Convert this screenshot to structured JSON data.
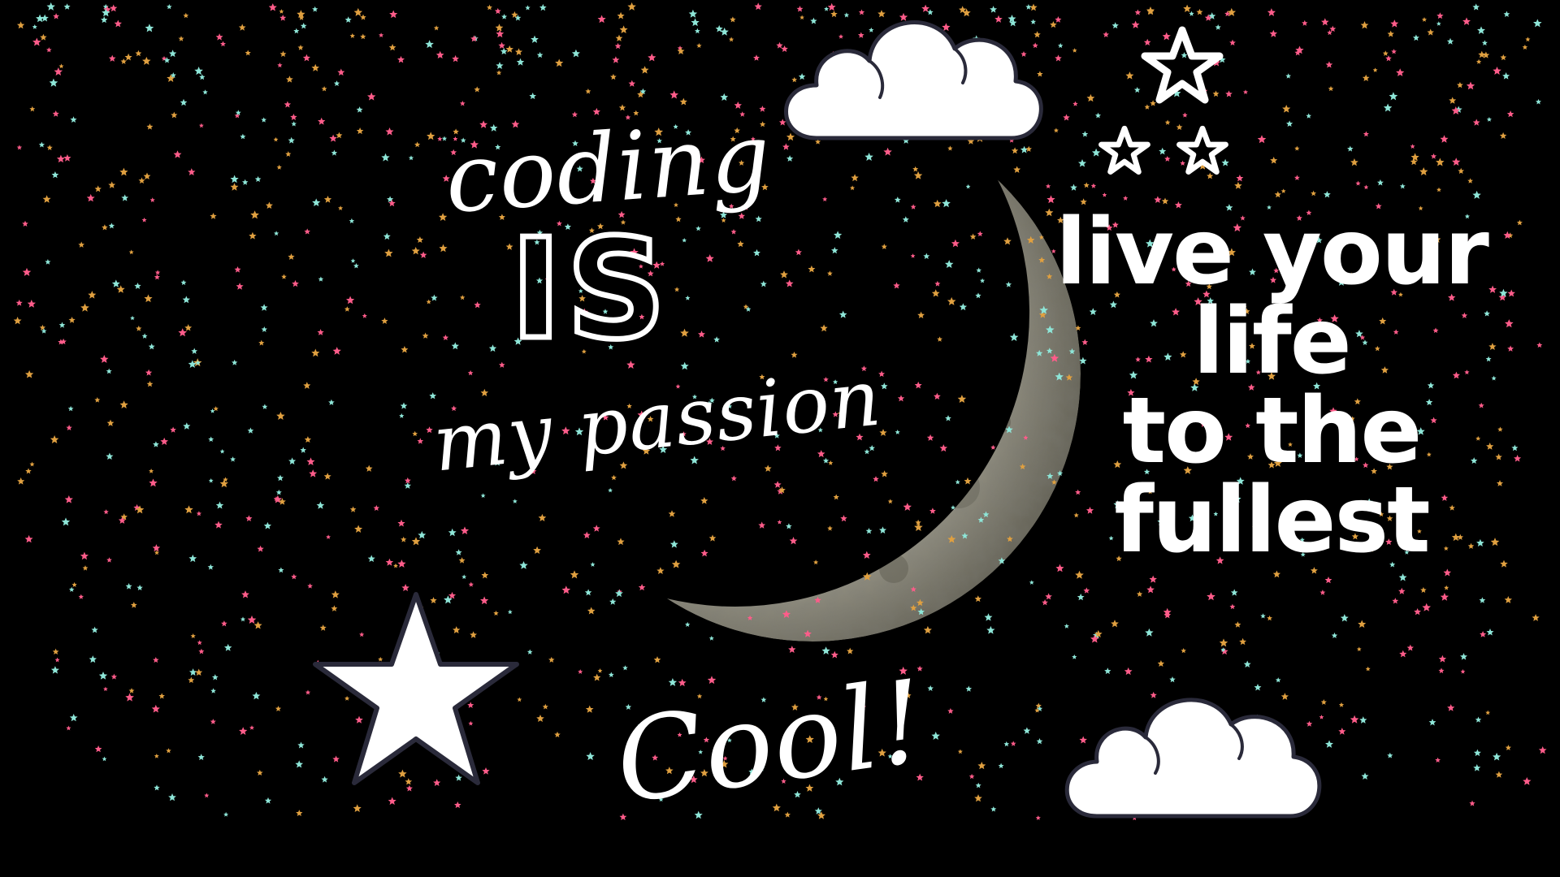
{
  "colors": {
    "background": "#000000",
    "text": "#ffffff",
    "confetti": [
      "#ff5c8a",
      "#8ee6d8",
      "#e0a040",
      "#ffffff"
    ],
    "cloud_outline": "#2a2a3a",
    "moon_light": "#c9c6b6",
    "moon_dark": "#3a3930"
  },
  "text": {
    "coding": "coding",
    "is": "IS",
    "passion": "my passion",
    "cool": "Cool!",
    "slogan_lines": [
      "live your",
      "life",
      "to the",
      "fullest"
    ]
  },
  "decorations": {
    "icons": [
      "cloud-icon",
      "star-outline-icon",
      "star-filled-icon",
      "crescent-moon"
    ]
  }
}
